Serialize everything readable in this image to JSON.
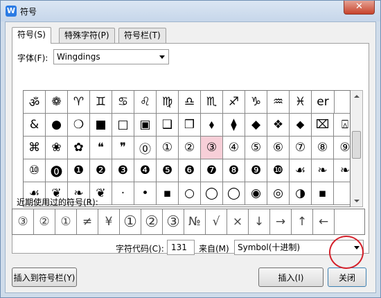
{
  "window": {
    "title": "符号",
    "app_icon_letter": "W",
    "close_glyph": "✕"
  },
  "tabs": [
    {
      "label": "符号(S)",
      "active": true
    },
    {
      "label": "特殊字符(P)",
      "active": false
    },
    {
      "label": "符号栏(T)",
      "active": false
    }
  ],
  "font": {
    "label": "字体(F):",
    "value": "Wingdings"
  },
  "symbol_grid": {
    "rows": [
      [
        "ॐ",
        "❁",
        "♈",
        "♊",
        "♋",
        "♌",
        "♍",
        "♎",
        "♏",
        "♐",
        "♑",
        "♒",
        "♓",
        "er"
      ],
      [
        "&",
        "●",
        "❍",
        "■",
        "□",
        "▣",
        "❑",
        "❒",
        "⬧",
        "⧫",
        "◆",
        "❖",
        "⬥",
        "⌧",
        "⍓"
      ],
      [
        "⌘",
        "❀",
        "✿",
        "❝",
        "❞",
        "⓪",
        "①",
        "②",
        "③",
        "④",
        "⑤",
        "⑥",
        "⑦",
        "⑧",
        "⑨"
      ],
      [
        "⑩",
        "⓿",
        "❶",
        "❷",
        "❸",
        "❹",
        "❺",
        "❻",
        "❼",
        "❽",
        "❾",
        "❿",
        "☙",
        "❧",
        "❧"
      ],
      [
        "☙",
        "❦",
        "❧",
        "❦",
        "·",
        "•",
        "▪",
        "○",
        "◯",
        "◯",
        "◉",
        "◎",
        "◑",
        "▪",
        ""
      ]
    ],
    "selected": "③"
  },
  "recent": {
    "label": "近期使用过的符号(R):",
    "symbols": [
      "③",
      "②",
      "①",
      "≠",
      "¥",
      "①",
      "②",
      "③",
      "№",
      "√",
      "×",
      "↓",
      "→",
      "↑",
      "←",
      ""
    ]
  },
  "char_code": {
    "label": "字符代码(C):",
    "value": "131"
  },
  "source": {
    "label": "来自(M)",
    "value": "Symbol(十进制)"
  },
  "buttons": {
    "insert_to_bar": "插入到符号栏(Y)",
    "insert": "插入(I)",
    "close": "关闭"
  },
  "colors": {
    "selected_cell": "#f7cfd8",
    "highlight_ring": "#d4202a"
  }
}
